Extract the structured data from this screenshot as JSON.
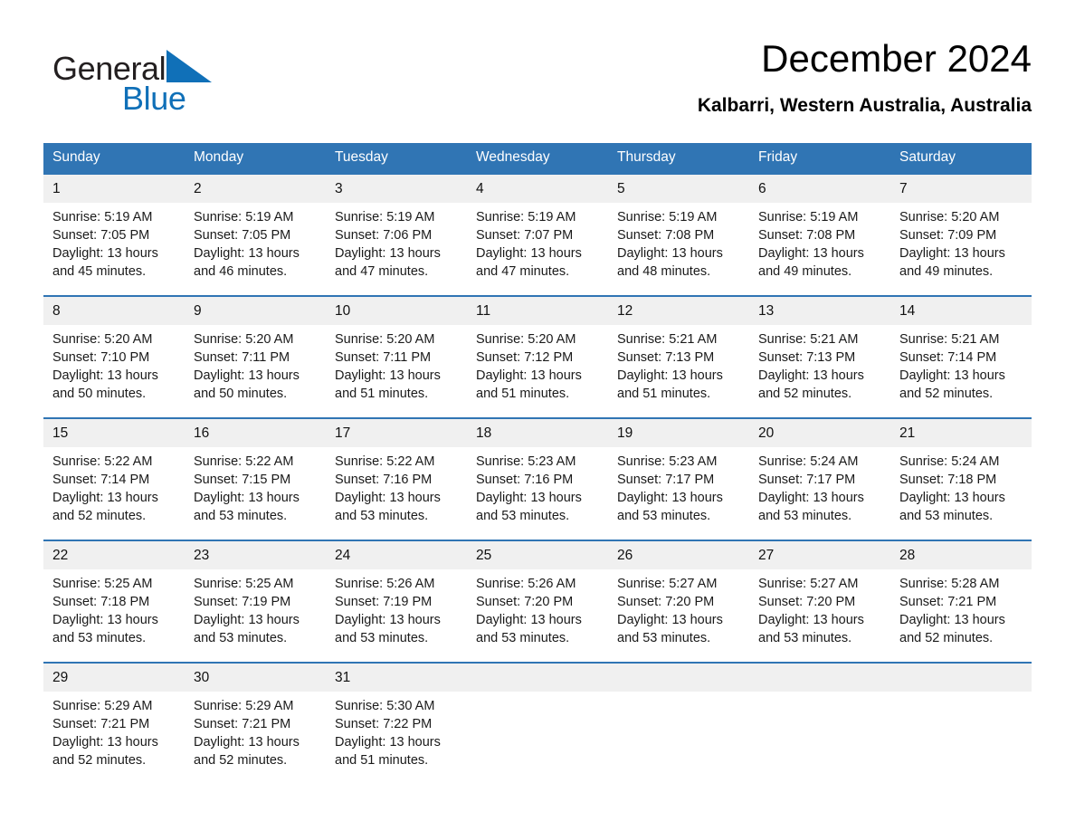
{
  "brand": {
    "word1": "General",
    "word2": "Blue",
    "triangle_color": "#1070b8",
    "text_color_dark": "#231f20",
    "text_color_blue": "#1070b8"
  },
  "header": {
    "title": "December 2024",
    "subtitle": "Kalbarri, Western Australia, Australia"
  },
  "theme": {
    "header_blue": "#3075b4",
    "daynum_band": "#f0f0f0",
    "row_rule": "#3075b4"
  },
  "weekdays": [
    "Sunday",
    "Monday",
    "Tuesday",
    "Wednesday",
    "Thursday",
    "Friday",
    "Saturday"
  ],
  "labels": {
    "sunrise_prefix": "Sunrise:",
    "sunset_prefix": "Sunset:",
    "daylight_prefix": "Daylight:"
  },
  "weeks": [
    [
      {
        "day": "1",
        "sunrise": "Sunrise: 5:19 AM",
        "sunset": "Sunset: 7:05 PM",
        "daylight_line1": "Daylight: 13 hours",
        "daylight_line2": "and 45 minutes."
      },
      {
        "day": "2",
        "sunrise": "Sunrise: 5:19 AM",
        "sunset": "Sunset: 7:05 PM",
        "daylight_line1": "Daylight: 13 hours",
        "daylight_line2": "and 46 minutes."
      },
      {
        "day": "3",
        "sunrise": "Sunrise: 5:19 AM",
        "sunset": "Sunset: 7:06 PM",
        "daylight_line1": "Daylight: 13 hours",
        "daylight_line2": "and 47 minutes."
      },
      {
        "day": "4",
        "sunrise": "Sunrise: 5:19 AM",
        "sunset": "Sunset: 7:07 PM",
        "daylight_line1": "Daylight: 13 hours",
        "daylight_line2": "and 47 minutes."
      },
      {
        "day": "5",
        "sunrise": "Sunrise: 5:19 AM",
        "sunset": "Sunset: 7:08 PM",
        "daylight_line1": "Daylight: 13 hours",
        "daylight_line2": "and 48 minutes."
      },
      {
        "day": "6",
        "sunrise": "Sunrise: 5:19 AM",
        "sunset": "Sunset: 7:08 PM",
        "daylight_line1": "Daylight: 13 hours",
        "daylight_line2": "and 49 minutes."
      },
      {
        "day": "7",
        "sunrise": "Sunrise: 5:20 AM",
        "sunset": "Sunset: 7:09 PM",
        "daylight_line1": "Daylight: 13 hours",
        "daylight_line2": "and 49 minutes."
      }
    ],
    [
      {
        "day": "8",
        "sunrise": "Sunrise: 5:20 AM",
        "sunset": "Sunset: 7:10 PM",
        "daylight_line1": "Daylight: 13 hours",
        "daylight_line2": "and 50 minutes."
      },
      {
        "day": "9",
        "sunrise": "Sunrise: 5:20 AM",
        "sunset": "Sunset: 7:11 PM",
        "daylight_line1": "Daylight: 13 hours",
        "daylight_line2": "and 50 minutes."
      },
      {
        "day": "10",
        "sunrise": "Sunrise: 5:20 AM",
        "sunset": "Sunset: 7:11 PM",
        "daylight_line1": "Daylight: 13 hours",
        "daylight_line2": "and 51 minutes."
      },
      {
        "day": "11",
        "sunrise": "Sunrise: 5:20 AM",
        "sunset": "Sunset: 7:12 PM",
        "daylight_line1": "Daylight: 13 hours",
        "daylight_line2": "and 51 minutes."
      },
      {
        "day": "12",
        "sunrise": "Sunrise: 5:21 AM",
        "sunset": "Sunset: 7:13 PM",
        "daylight_line1": "Daylight: 13 hours",
        "daylight_line2": "and 51 minutes."
      },
      {
        "day": "13",
        "sunrise": "Sunrise: 5:21 AM",
        "sunset": "Sunset: 7:13 PM",
        "daylight_line1": "Daylight: 13 hours",
        "daylight_line2": "and 52 minutes."
      },
      {
        "day": "14",
        "sunrise": "Sunrise: 5:21 AM",
        "sunset": "Sunset: 7:14 PM",
        "daylight_line1": "Daylight: 13 hours",
        "daylight_line2": "and 52 minutes."
      }
    ],
    [
      {
        "day": "15",
        "sunrise": "Sunrise: 5:22 AM",
        "sunset": "Sunset: 7:14 PM",
        "daylight_line1": "Daylight: 13 hours",
        "daylight_line2": "and 52 minutes."
      },
      {
        "day": "16",
        "sunrise": "Sunrise: 5:22 AM",
        "sunset": "Sunset: 7:15 PM",
        "daylight_line1": "Daylight: 13 hours",
        "daylight_line2": "and 53 minutes."
      },
      {
        "day": "17",
        "sunrise": "Sunrise: 5:22 AM",
        "sunset": "Sunset: 7:16 PM",
        "daylight_line1": "Daylight: 13 hours",
        "daylight_line2": "and 53 minutes."
      },
      {
        "day": "18",
        "sunrise": "Sunrise: 5:23 AM",
        "sunset": "Sunset: 7:16 PM",
        "daylight_line1": "Daylight: 13 hours",
        "daylight_line2": "and 53 minutes."
      },
      {
        "day": "19",
        "sunrise": "Sunrise: 5:23 AM",
        "sunset": "Sunset: 7:17 PM",
        "daylight_line1": "Daylight: 13 hours",
        "daylight_line2": "and 53 minutes."
      },
      {
        "day": "20",
        "sunrise": "Sunrise: 5:24 AM",
        "sunset": "Sunset: 7:17 PM",
        "daylight_line1": "Daylight: 13 hours",
        "daylight_line2": "and 53 minutes."
      },
      {
        "day": "21",
        "sunrise": "Sunrise: 5:24 AM",
        "sunset": "Sunset: 7:18 PM",
        "daylight_line1": "Daylight: 13 hours",
        "daylight_line2": "and 53 minutes."
      }
    ],
    [
      {
        "day": "22",
        "sunrise": "Sunrise: 5:25 AM",
        "sunset": "Sunset: 7:18 PM",
        "daylight_line1": "Daylight: 13 hours",
        "daylight_line2": "and 53 minutes."
      },
      {
        "day": "23",
        "sunrise": "Sunrise: 5:25 AM",
        "sunset": "Sunset: 7:19 PM",
        "daylight_line1": "Daylight: 13 hours",
        "daylight_line2": "and 53 minutes."
      },
      {
        "day": "24",
        "sunrise": "Sunrise: 5:26 AM",
        "sunset": "Sunset: 7:19 PM",
        "daylight_line1": "Daylight: 13 hours",
        "daylight_line2": "and 53 minutes."
      },
      {
        "day": "25",
        "sunrise": "Sunrise: 5:26 AM",
        "sunset": "Sunset: 7:20 PM",
        "daylight_line1": "Daylight: 13 hours",
        "daylight_line2": "and 53 minutes."
      },
      {
        "day": "26",
        "sunrise": "Sunrise: 5:27 AM",
        "sunset": "Sunset: 7:20 PM",
        "daylight_line1": "Daylight: 13 hours",
        "daylight_line2": "and 53 minutes."
      },
      {
        "day": "27",
        "sunrise": "Sunrise: 5:27 AM",
        "sunset": "Sunset: 7:20 PM",
        "daylight_line1": "Daylight: 13 hours",
        "daylight_line2": "and 53 minutes."
      },
      {
        "day": "28",
        "sunrise": "Sunrise: 5:28 AM",
        "sunset": "Sunset: 7:21 PM",
        "daylight_line1": "Daylight: 13 hours",
        "daylight_line2": "and 52 minutes."
      }
    ],
    [
      {
        "day": "29",
        "sunrise": "Sunrise: 5:29 AM",
        "sunset": "Sunset: 7:21 PM",
        "daylight_line1": "Daylight: 13 hours",
        "daylight_line2": "and 52 minutes."
      },
      {
        "day": "30",
        "sunrise": "Sunrise: 5:29 AM",
        "sunset": "Sunset: 7:21 PM",
        "daylight_line1": "Daylight: 13 hours",
        "daylight_line2": "and 52 minutes."
      },
      {
        "day": "31",
        "sunrise": "Sunrise: 5:30 AM",
        "sunset": "Sunset: 7:22 PM",
        "daylight_line1": "Daylight: 13 hours",
        "daylight_line2": "and 51 minutes."
      },
      {
        "day": "",
        "sunrise": "",
        "sunset": "",
        "daylight_line1": "",
        "daylight_line2": ""
      },
      {
        "day": "",
        "sunrise": "",
        "sunset": "",
        "daylight_line1": "",
        "daylight_line2": ""
      },
      {
        "day": "",
        "sunrise": "",
        "sunset": "",
        "daylight_line1": "",
        "daylight_line2": ""
      },
      {
        "day": "",
        "sunrise": "",
        "sunset": "",
        "daylight_line1": "",
        "daylight_line2": ""
      }
    ]
  ]
}
